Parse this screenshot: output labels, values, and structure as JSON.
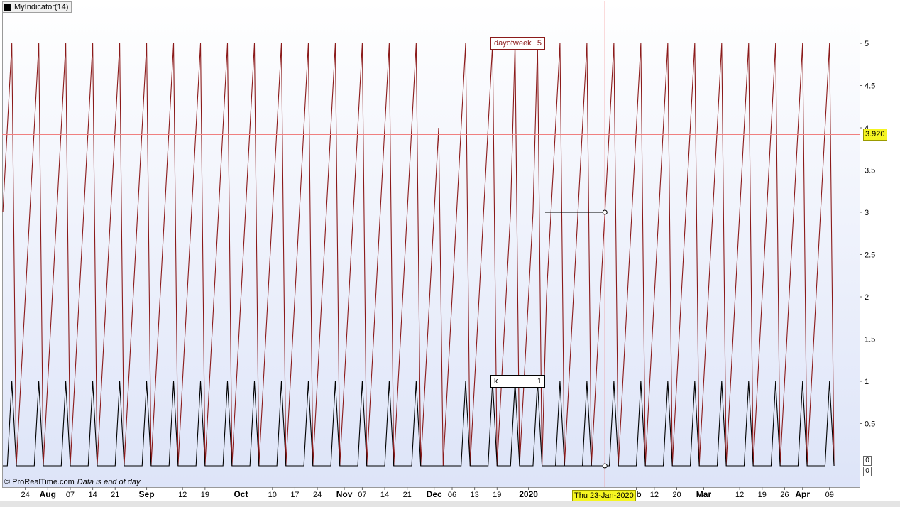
{
  "indicator_title": "MyIndicator(14)",
  "footer": {
    "brand": "© ProRealTime.com",
    "note": "Data is end of day"
  },
  "crosshair": {
    "date_label": "Thu 23-Jan-2020",
    "value_label": "3.920",
    "value": 3.92,
    "date_index": 134
  },
  "zero_labels": [
    "0",
    "0"
  ],
  "series_labels": {
    "dayofweek": {
      "name": "dayofweek",
      "value": "5"
    },
    "k": {
      "name": "k",
      "value": "1"
    }
  },
  "colors": {
    "dayofweek": "#8b1a1a",
    "k": "#000000",
    "crosshair": "#f08080",
    "highlight": "#f5f521",
    "background_top": "#ffffff",
    "background_bottom": "#dde4f8"
  },
  "chart_data": {
    "type": "line",
    "y_axis": {
      "min": 0,
      "max": 5,
      "ticks": [
        "5",
        "4.5",
        "4",
        "3.5",
        "3",
        "2.5",
        "2",
        "1.5",
        "1",
        "0.5"
      ]
    },
    "x_labels": [
      {
        "text": "24",
        "idx": 5,
        "bold": false
      },
      {
        "text": "Aug",
        "idx": 10,
        "bold": true
      },
      {
        "text": "07",
        "idx": 15,
        "bold": false
      },
      {
        "text": "14",
        "idx": 20,
        "bold": false
      },
      {
        "text": "21",
        "idx": 25,
        "bold": false
      },
      {
        "text": "Sep",
        "idx": 32,
        "bold": true
      },
      {
        "text": "12",
        "idx": 40,
        "bold": false
      },
      {
        "text": "19",
        "idx": 45,
        "bold": false
      },
      {
        "text": "Oct",
        "idx": 53,
        "bold": true
      },
      {
        "text": "10",
        "idx": 60,
        "bold": false
      },
      {
        "text": "17",
        "idx": 65,
        "bold": false
      },
      {
        "text": "24",
        "idx": 70,
        "bold": false
      },
      {
        "text": "Nov",
        "idx": 76,
        "bold": true
      },
      {
        "text": "07",
        "idx": 80,
        "bold": false
      },
      {
        "text": "14",
        "idx": 85,
        "bold": false
      },
      {
        "text": "21",
        "idx": 90,
        "bold": false
      },
      {
        "text": "Dec",
        "idx": 96,
        "bold": true
      },
      {
        "text": "06",
        "idx": 100,
        "bold": false
      },
      {
        "text": "13",
        "idx": 105,
        "bold": false
      },
      {
        "text": "19",
        "idx": 110,
        "bold": false
      },
      {
        "text": "2020",
        "idx": 117,
        "bold": true
      },
      {
        "text": "eb",
        "idx": 141,
        "bold": true
      },
      {
        "text": "12",
        "idx": 145,
        "bold": false
      },
      {
        "text": "20",
        "idx": 150,
        "bold": false
      },
      {
        "text": "Mar",
        "idx": 156,
        "bold": true
      },
      {
        "text": "12",
        "idx": 164,
        "bold": false
      },
      {
        "text": "19",
        "idx": 169,
        "bold": false
      },
      {
        "text": "26",
        "idx": 174,
        "bold": false
      },
      {
        "text": "Apr",
        "idx": 178,
        "bold": true
      },
      {
        "text": "09",
        "idx": 184,
        "bold": false
      }
    ],
    "series": [
      {
        "name": "dayofweek",
        "values": [
          3,
          4,
          5,
          0,
          1,
          2,
          3,
          4,
          5,
          0,
          1,
          2,
          3,
          4,
          5,
          0,
          1,
          2,
          3,
          4,
          5,
          0,
          1,
          2,
          3,
          4,
          5,
          0,
          1,
          2,
          3,
          4,
          5,
          0,
          1,
          2,
          3,
          4,
          5,
          0,
          1,
          2,
          3,
          4,
          5,
          0,
          1,
          2,
          3,
          4,
          5,
          0,
          1,
          2,
          3,
          4,
          5,
          0,
          1,
          2,
          3,
          4,
          5,
          0,
          1,
          2,
          3,
          4,
          5,
          0,
          1,
          2,
          3,
          4,
          5,
          0,
          1,
          2,
          3,
          4,
          5,
          0,
          1,
          2,
          3,
          4,
          5,
          0,
          1,
          2,
          3,
          4,
          5,
          0,
          1,
          2,
          3,
          4,
          0,
          1,
          2,
          3,
          4,
          5,
          0,
          1,
          2,
          3,
          4,
          5,
          0,
          1,
          2,
          3,
          5,
          0,
          1,
          2,
          3,
          5,
          0,
          2,
          3,
          4,
          5,
          0,
          1,
          2,
          3,
          4,
          5,
          0,
          1,
          2,
          3,
          4,
          5,
          0,
          1,
          2,
          3,
          4,
          5,
          0,
          1,
          2,
          3,
          4,
          5,
          0,
          1,
          2,
          3,
          4,
          5,
          0,
          1,
          2,
          3,
          4,
          5,
          0,
          1,
          2,
          3,
          4,
          5,
          0,
          1,
          2,
          3,
          4,
          5,
          0,
          1,
          2,
          3,
          4,
          5,
          0,
          1,
          2,
          3,
          4,
          5,
          0
        ]
      },
      {
        "name": "k",
        "values": [
          0,
          0,
          1,
          0,
          0,
          0,
          0,
          0,
          1,
          0,
          0,
          0,
          0,
          0,
          1,
          0,
          0,
          0,
          0,
          0,
          1,
          0,
          0,
          0,
          0,
          0,
          1,
          0,
          0,
          0,
          0,
          0,
          1,
          0,
          0,
          0,
          0,
          0,
          1,
          0,
          0,
          0,
          0,
          0,
          1,
          0,
          0,
          0,
          0,
          0,
          1,
          0,
          0,
          0,
          0,
          0,
          1,
          0,
          0,
          0,
          0,
          0,
          1,
          0,
          0,
          0,
          0,
          0,
          1,
          0,
          0,
          0,
          0,
          0,
          1,
          0,
          0,
          0,
          0,
          0,
          1,
          0,
          0,
          0,
          0,
          0,
          1,
          0,
          0,
          0,
          0,
          0,
          1,
          0,
          0,
          0,
          0,
          0,
          0,
          0,
          0,
          0,
          0,
          1,
          0,
          0,
          0,
          0,
          0,
          1,
          0,
          0,
          0,
          0,
          1,
          0,
          0,
          0,
          0,
          1,
          0,
          0,
          0,
          0,
          1,
          0,
          0,
          0,
          0,
          0,
          1,
          0,
          0,
          0,
          0,
          0,
          1,
          0,
          0,
          0,
          0,
          0,
          1,
          0,
          0,
          0,
          0,
          0,
          1,
          0,
          0,
          0,
          0,
          0,
          1,
          0,
          0,
          0,
          0,
          0,
          1,
          0,
          0,
          0,
          0,
          0,
          1,
          0,
          0,
          0,
          0,
          0,
          1,
          0,
          0,
          0,
          0,
          0,
          1,
          0,
          0,
          0,
          0,
          0,
          1,
          0
        ]
      }
    ]
  }
}
